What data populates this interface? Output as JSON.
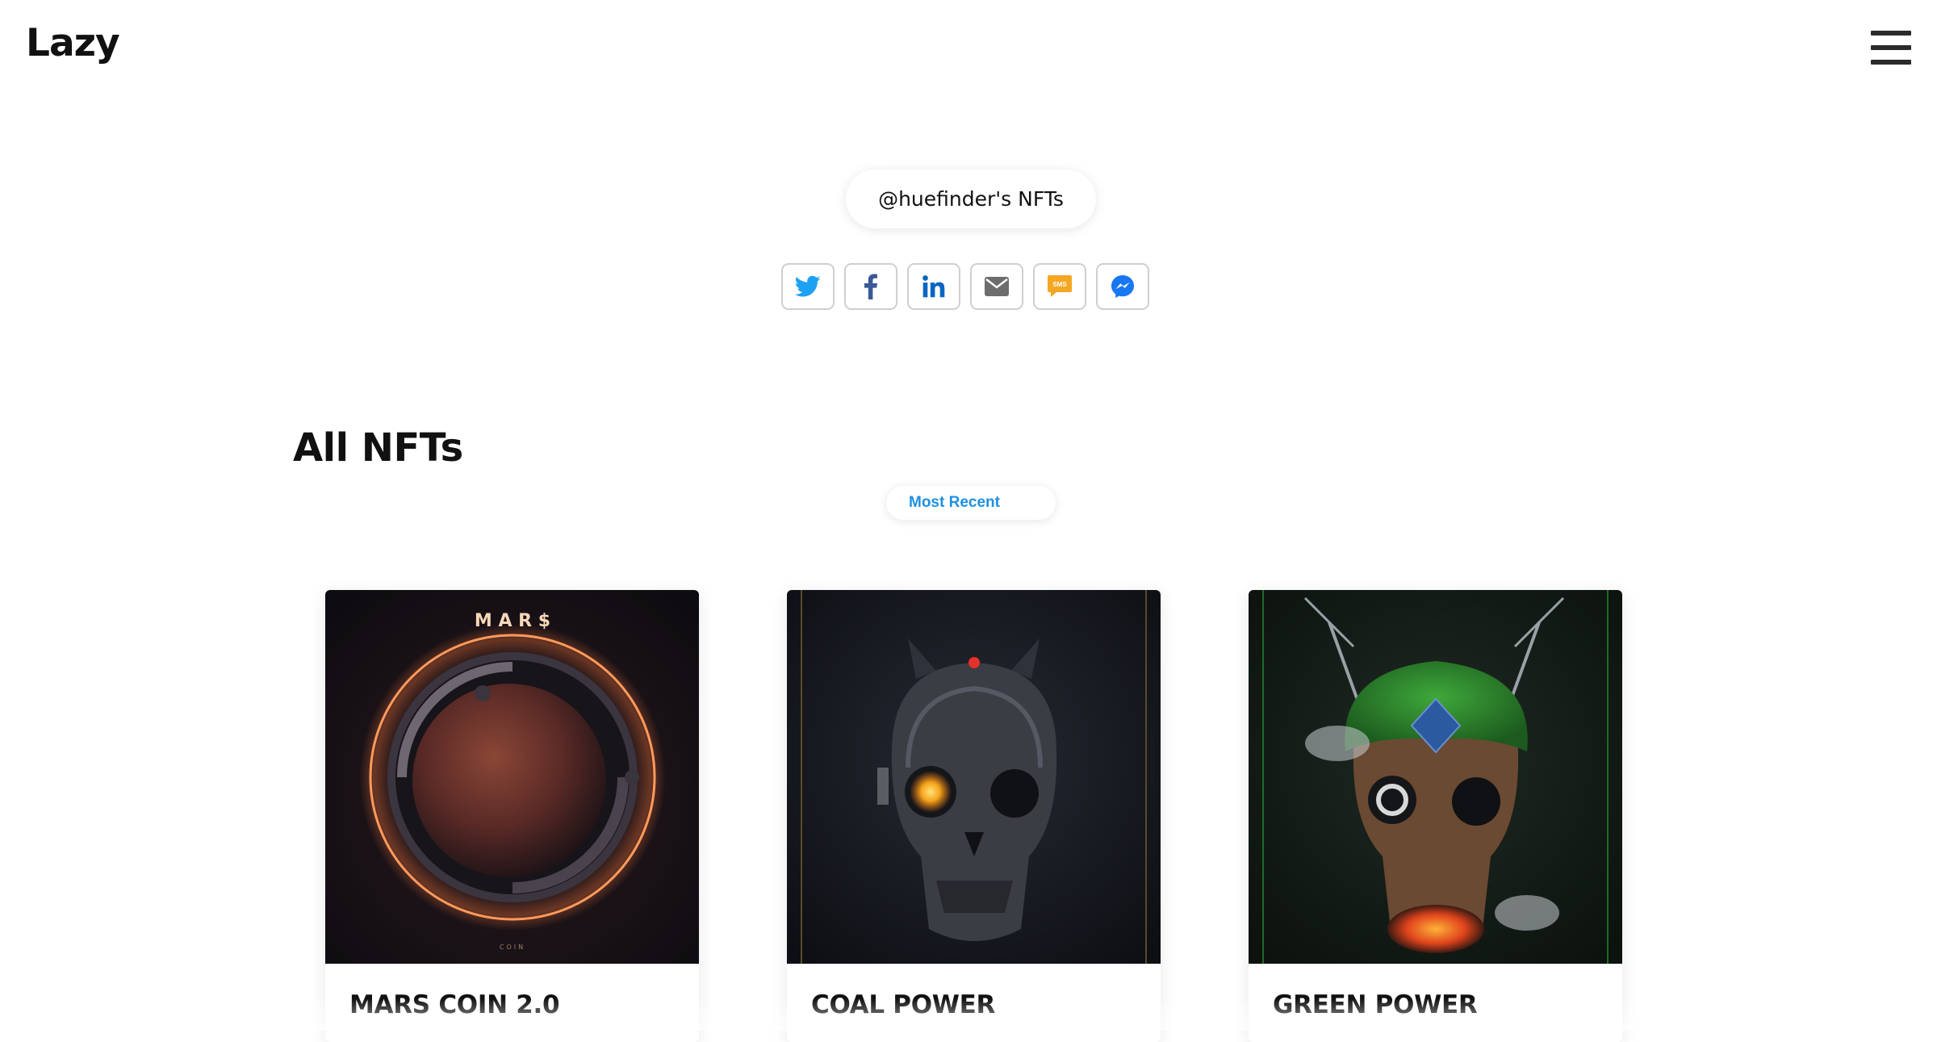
{
  "header": {
    "logo_text": "Lazy",
    "menu_icon": "hamburger-menu-icon"
  },
  "profile": {
    "pill_label": "@huefinder's NFTs"
  },
  "share": {
    "buttons": [
      {
        "icon": "twitter-icon",
        "color": "#1da1f2"
      },
      {
        "icon": "facebook-icon",
        "color": "#3b5998"
      },
      {
        "icon": "linkedin-icon",
        "color": "#0a66c2"
      },
      {
        "icon": "email-icon",
        "color": "#6d6d6d"
      },
      {
        "icon": "sms-icon",
        "color": "#f5a623",
        "text": "SMS"
      },
      {
        "icon": "messenger-icon",
        "color": "#1877f2"
      }
    ]
  },
  "main": {
    "section_title": "All NFTs",
    "sort_label": "Most Recent",
    "accent_color": "#1e90e0",
    "cards": [
      {
        "title": "MARS COIN 2.0",
        "art_text_top": "M A R $",
        "art_text_bottom": "COIN"
      },
      {
        "title": "COAL POWER"
      },
      {
        "title": "GREEN POWER"
      }
    ]
  }
}
